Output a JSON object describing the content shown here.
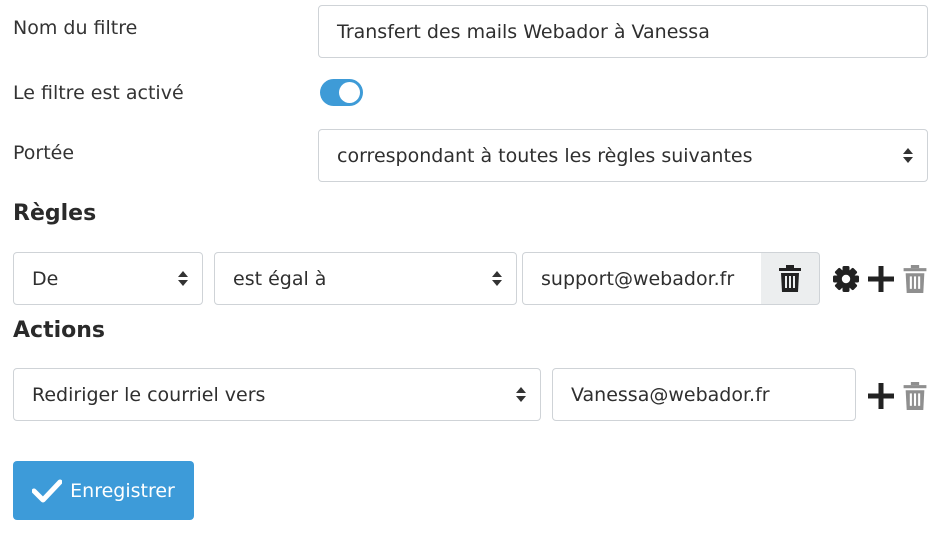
{
  "filter_name": {
    "label": "Nom du filtre",
    "value": "Transfert des mails Webador à Vanessa"
  },
  "filter_active": {
    "label": "Le filtre est activé",
    "checked": true
  },
  "scope": {
    "label": "Portée",
    "value": "correspondant à toutes les règles suivantes"
  },
  "rules": {
    "heading": "Règles",
    "items": [
      {
        "header": "De",
        "operator": "est égal à",
        "value": "support@webador.fr"
      }
    ]
  },
  "actions": {
    "heading": "Actions",
    "items": [
      {
        "type": "Rediriger le courriel vers",
        "target": "Vanessa@webador.fr"
      }
    ]
  },
  "save_button": {
    "label": "Enregistrer"
  },
  "colors": {
    "accent": "#3d9bd9",
    "toggle": "#3e9bd7",
    "icon_dark": "#222222",
    "icon_muted": "#8f8f8f"
  }
}
